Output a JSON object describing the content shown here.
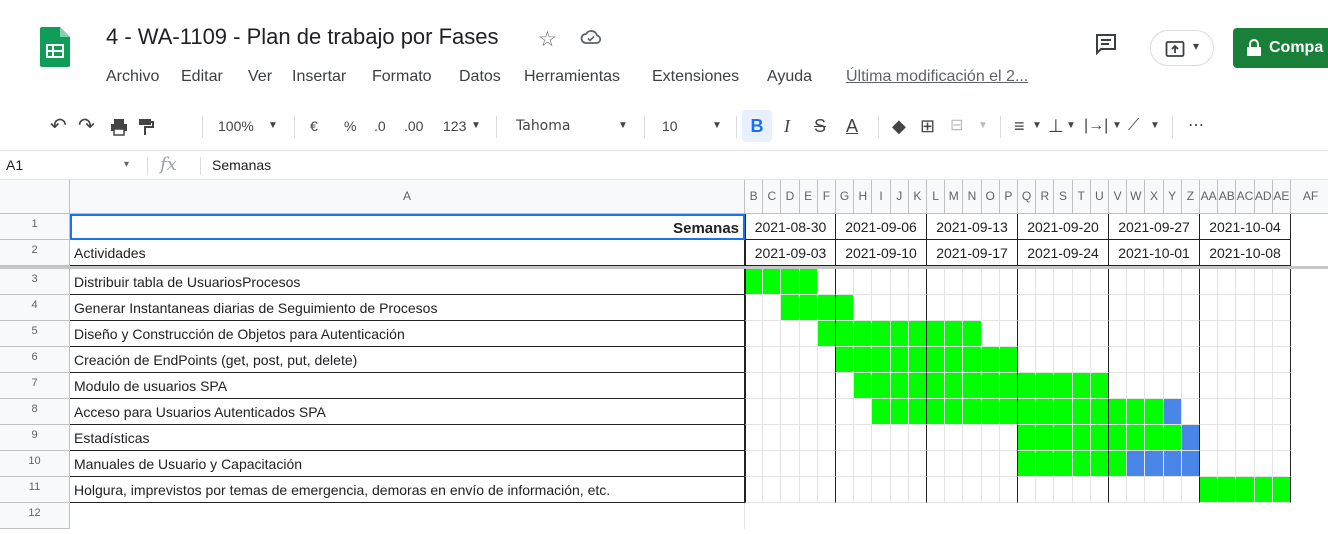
{
  "app": {
    "title": "4 - WA-1109 - Plan de trabajo por Fases",
    "menu": [
      "Archivo",
      "Editar",
      "Ver",
      "Insertar",
      "Formato",
      "Datos",
      "Herramientas",
      "Extensiones",
      "Ayuda"
    ],
    "last_modified": "Última modificación el 2...",
    "share_label": "Compa"
  },
  "toolbar": {
    "zoom": "100%",
    "currency": "€",
    "percent": "%",
    "dec_decrease": ".0",
    "dec_increase": ".00",
    "number_format": "123",
    "font": "Tahoma",
    "font_size": "10",
    "bold": "B",
    "italic": "I",
    "strike": "S",
    "text_color": "A",
    "more": "⋯"
  },
  "formula_bar": {
    "cell": "A1",
    "value": "Semanas"
  },
  "colors": {
    "done": "#00ff00",
    "delay": "#4a86e8"
  },
  "sheet": {
    "col_a_header": "A",
    "col_letters": [
      "B",
      "C",
      "D",
      "E",
      "F",
      "G",
      "H",
      "I",
      "J",
      "K",
      "L",
      "M",
      "N",
      "O",
      "P",
      "Q",
      "R",
      "S",
      "T",
      "U",
      "V",
      "W",
      "X",
      "Y",
      "Z",
      "AA",
      "AB",
      "AC",
      "AD",
      "AE",
      "AF"
    ],
    "row_numbers": [
      "1",
      "2",
      "3",
      "4",
      "5",
      "6",
      "7",
      "8",
      "9",
      "10",
      "11",
      "12"
    ],
    "row1_label": "Semanas",
    "row2_label": "Actividades",
    "week_start": [
      "2021-08-30",
      "2021-09-06",
      "2021-09-13",
      "2021-09-20",
      "2021-09-27",
      "2021-10-04"
    ],
    "week_end": [
      "2021-09-03",
      "2021-09-10",
      "2021-09-17",
      "2021-09-24",
      "2021-10-01",
      "2021-10-08"
    ],
    "activities": [
      {
        "name": "Distribuir tabla de UsuariosProcesos",
        "green": [
          0,
          3
        ],
        "blue": null
      },
      {
        "name": "Generar Instantaneas diarias de Seguimiento de Procesos",
        "green": [
          2,
          5
        ],
        "blue": null
      },
      {
        "name": "Diseño y Construcción de Objetos para Autenticación",
        "green": [
          4,
          12
        ],
        "blue": null
      },
      {
        "name": "Creación de EndPoints (get, post, put, delete)",
        "green": [
          5,
          14
        ],
        "blue": null
      },
      {
        "name": "Modulo de usuarios SPA",
        "green": [
          6,
          19
        ],
        "blue": null
      },
      {
        "name": "Acceso para Usuarios Autenticados SPA",
        "green": [
          7,
          22
        ],
        "blue": [
          23,
          23
        ]
      },
      {
        "name": "Estadísticas",
        "green": [
          15,
          23
        ],
        "blue": [
          24,
          24
        ]
      },
      {
        "name": "Manuales de Usuario y Capacitación",
        "green": [
          15,
          20
        ],
        "blue": [
          21,
          24
        ]
      },
      {
        "name": "Holgura, imprevistos por temas de emergencia, demoras en envío de información, etc.",
        "green": [
          25,
          29
        ],
        "blue": null
      }
    ]
  }
}
